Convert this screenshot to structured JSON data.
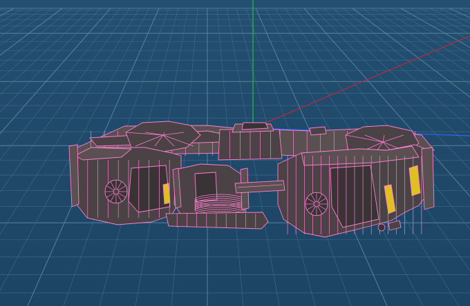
{
  "viewport": {
    "background_color": "#20496a",
    "grid_color": "#3f6f91",
    "grid_major_color": "#5a86a5",
    "axis_colors": {
      "x": "#c0283a",
      "y": "#22c23a",
      "z": "#3366ff"
    }
  },
  "model": {
    "wire_color": "#ff7fd0",
    "body_color": "#4a4244",
    "shade_color": "#3a3335",
    "hilite_color": "#5a5052",
    "stripe_color": "#e0c020"
  }
}
